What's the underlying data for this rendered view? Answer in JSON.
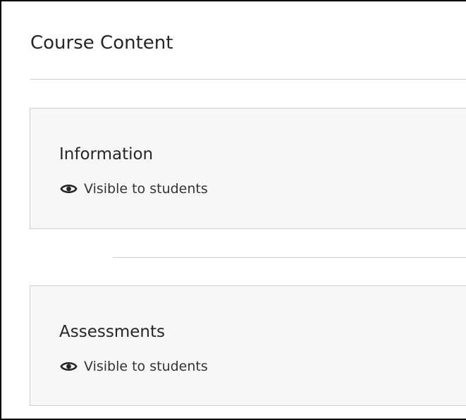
{
  "page": {
    "title": "Course Content"
  },
  "content_items": [
    {
      "title": "Information",
      "visibility": "Visible to students",
      "icon": "eye-icon"
    },
    {
      "title": "Assessments",
      "visibility": "Visible to students",
      "icon": "eye-icon"
    }
  ],
  "colors": {
    "text": "#262626",
    "card_background": "#f7f7f7",
    "divider": "#cdcdcd"
  }
}
